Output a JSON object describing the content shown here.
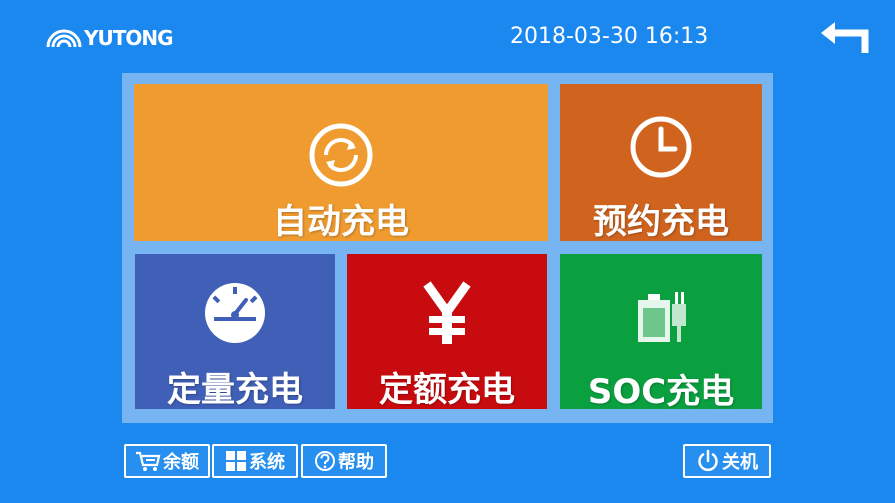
{
  "header": {
    "logo_text": "YUTONG",
    "datetime": "2018-03-30 16:13"
  },
  "tiles": {
    "auto": {
      "label": "自动充电",
      "color": "#ef9b30",
      "icon": "refresh-icon"
    },
    "scheduled": {
      "label": "预约充电",
      "color": "#d0641f",
      "icon": "clock-icon"
    },
    "quantity": {
      "label": "定量充电",
      "color": "#4060b8",
      "icon": "gauge-icon"
    },
    "amount": {
      "label": "定额充电",
      "color": "#c80b0e",
      "icon": "yen-icon"
    },
    "soc": {
      "label": "SOC充电",
      "color": "#0aa040",
      "icon": "battery-plug-icon"
    }
  },
  "bottom_bar": {
    "balance": "余额",
    "system": "系统",
    "help": "帮助",
    "power": "关机"
  },
  "colors": {
    "background": "#1a88ee",
    "panel": "#76b4f2"
  }
}
